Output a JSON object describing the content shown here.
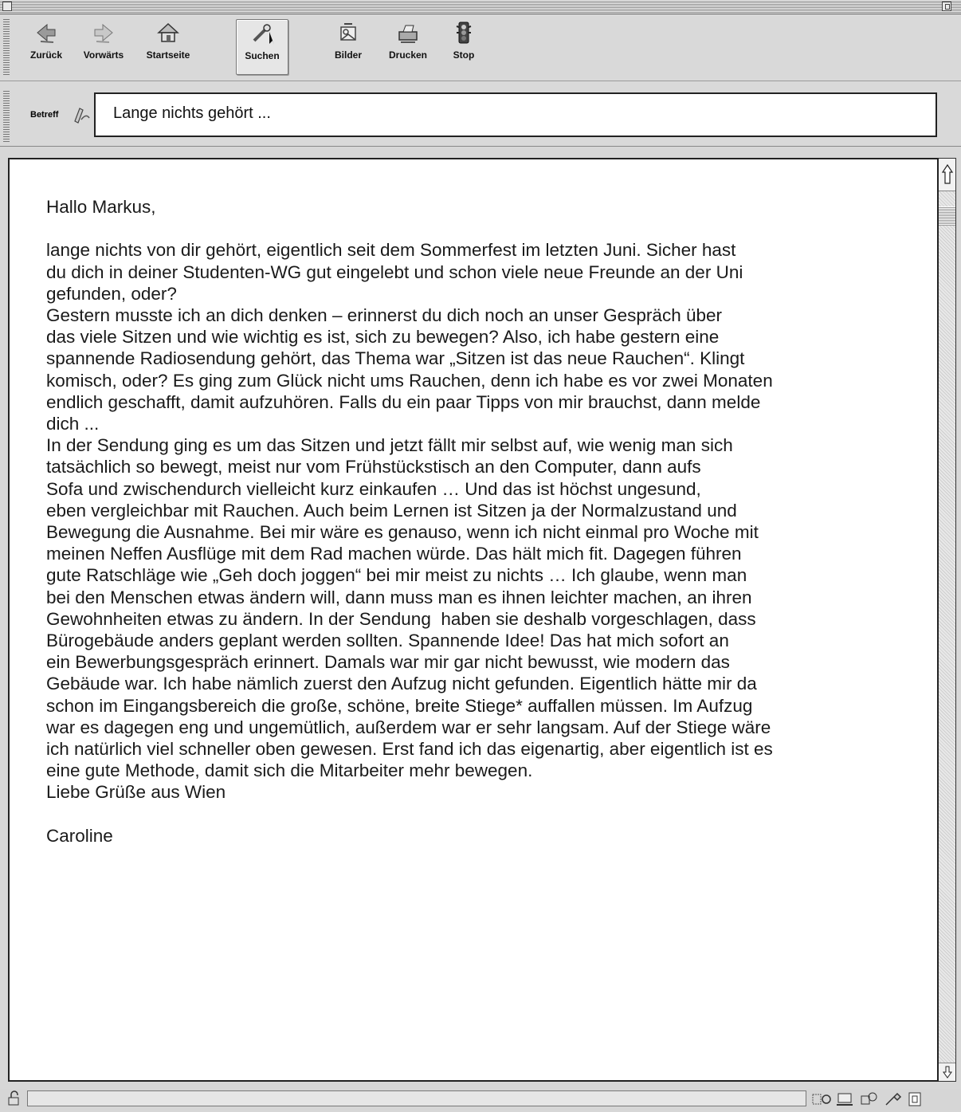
{
  "toolbar": {
    "buttons": [
      {
        "label": "Zurück",
        "icon": "back-arrow-icon"
      },
      {
        "label": "Vorwärts",
        "icon": "forward-arrow-icon"
      },
      {
        "label": "Startseite",
        "icon": "home-icon"
      },
      {
        "label": "Suchen",
        "icon": "search-icon"
      },
      {
        "label": "Bilder",
        "icon": "images-icon"
      },
      {
        "label": "Drucken",
        "icon": "printer-icon"
      },
      {
        "label": "Stop",
        "icon": "stop-icon"
      }
    ]
  },
  "subject": {
    "label": "Betreff",
    "value": "Lange nichts gehört ..."
  },
  "email": {
    "body": "Hallo Markus,\n\nlange nichts von dir gehört, eigentlich seit dem Sommerfest im letzten Juni. Sicher hast\ndu dich in deiner Studenten-WG gut eingelebt und schon viele neue Freunde an der Uni\ngefunden, oder?\nGestern musste ich an dich denken – erinnerst du dich noch an unser Gespräch über\ndas viele Sitzen und wie wichtig es ist, sich zu bewegen? Also, ich habe gestern eine\nspannende Radiosendung gehört, das Thema war „Sitzen ist das neue Rauchen“. Klingt\nkomisch, oder? Es ging zum Glück nicht ums Rauchen, denn ich habe es vor zwei Monaten\nendlich geschafft, damit aufzuhören. Falls du ein paar Tipps von mir brauchst, dann melde\ndich ...\nIn der Sendung ging es um das Sitzen und jetzt fällt mir selbst auf, wie wenig man sich\ntatsächlich so bewegt, meist nur vom Frühstückstisch an den Computer, dann aufs\nSofa und zwischendurch vielleicht kurz einkaufen … Und das ist höchst ungesund,\neben vergleichbar mit Rauchen. Auch beim Lernen ist Sitzen ja der Normalzustand und\nBewegung die Ausnahme. Bei mir wäre es genauso, wenn ich nicht einmal pro Woche mit\nmeinen Neffen Ausflüge mit dem Rad machen würde. Das hält mich fit. Dagegen führen\ngute Ratschläge wie „Geh doch joggen“ bei mir meist zu nichts … Ich glaube, wenn man\nbei den Menschen etwas ändern will, dann muss man es ihnen leichter machen, an ihren\nGewohnheiten etwas zu ändern. In der Sendung  haben sie deshalb vorgeschlagen, dass\nBürogebäude anders geplant werden sollten. Spannende Idee! Das hat mich sofort an\nein Bewerbungsgespräch erinnert. Damals war mir gar nicht bewusst, wie modern das\nGebäude war. Ich habe nämlich zuerst den Aufzug nicht gefunden. Eigentlich hätte mir da\nschon im Eingangsbereich die große, schöne, breite Stiege* auffallen müssen. Im Aufzug\nwar es dagegen eng und ungemütlich, außerdem war er sehr langsam. Auf der Stiege wäre\nich natürlich viel schneller oben gewesen. Erst fand ich das eigenartig, aber eigentlich ist es\neine gute Methode, damit sich die Mitarbeiter mehr bewegen.\nLiebe Grüße aus Wien\n\nCaroline"
  },
  "statusbar": {
    "icons": [
      "lock-icon",
      "status-icon-1",
      "status-icon-2",
      "status-icon-3",
      "status-icon-4",
      "status-icon-5"
    ]
  }
}
